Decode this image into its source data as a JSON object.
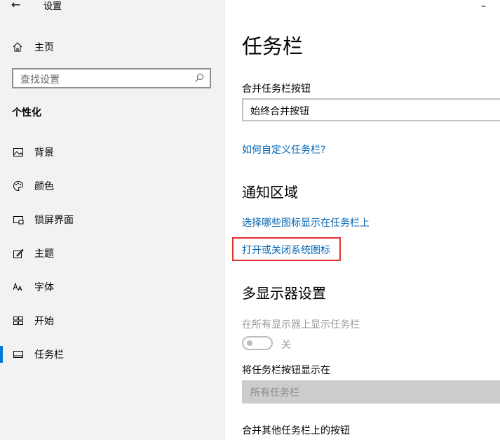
{
  "window": {
    "title": "设置",
    "back_icon": "arrow-left-icon",
    "minimize_glyph": "–"
  },
  "sidebar": {
    "home_label": "主页",
    "home_icon": "home-icon",
    "search_placeholder": "查找设置",
    "search_icon": "search-icon",
    "section_title": "个性化",
    "items": [
      {
        "label": "背景",
        "icon": "picture-icon"
      },
      {
        "label": "颜色",
        "icon": "palette-icon"
      },
      {
        "label": "锁屏界面",
        "icon": "lock-screen-icon"
      },
      {
        "label": "主题",
        "icon": "theme-brush-icon"
      },
      {
        "label": "字体",
        "icon": "font-icon"
      },
      {
        "label": "开始",
        "icon": "start-tiles-icon"
      },
      {
        "label": "任务栏",
        "icon": "taskbar-icon",
        "selected": true
      }
    ],
    "accent_color": "#0078d7"
  },
  "main": {
    "page_title": "任务栏",
    "combine_label": "合并任务栏按钮",
    "combine_value": "始终合并按钮",
    "customize_link": "如何自定义任务栏?",
    "notification_heading": "通知区域",
    "select_icons_link": "选择哪些图标显示在任务栏上",
    "system_icons_link": "打开或关闭系统图标",
    "multi_display_heading": "多显示器设置",
    "show_on_all_label": "在所有显示器上显示任务栏",
    "toggle_state": "关",
    "show_buttons_label": "将任务栏按钮显示在",
    "show_buttons_value": "所有任务栏",
    "combine_other_label": "合并其他任务栏上的按钮",
    "link_color": "#0063b1",
    "highlight_color": "#e0322f"
  }
}
